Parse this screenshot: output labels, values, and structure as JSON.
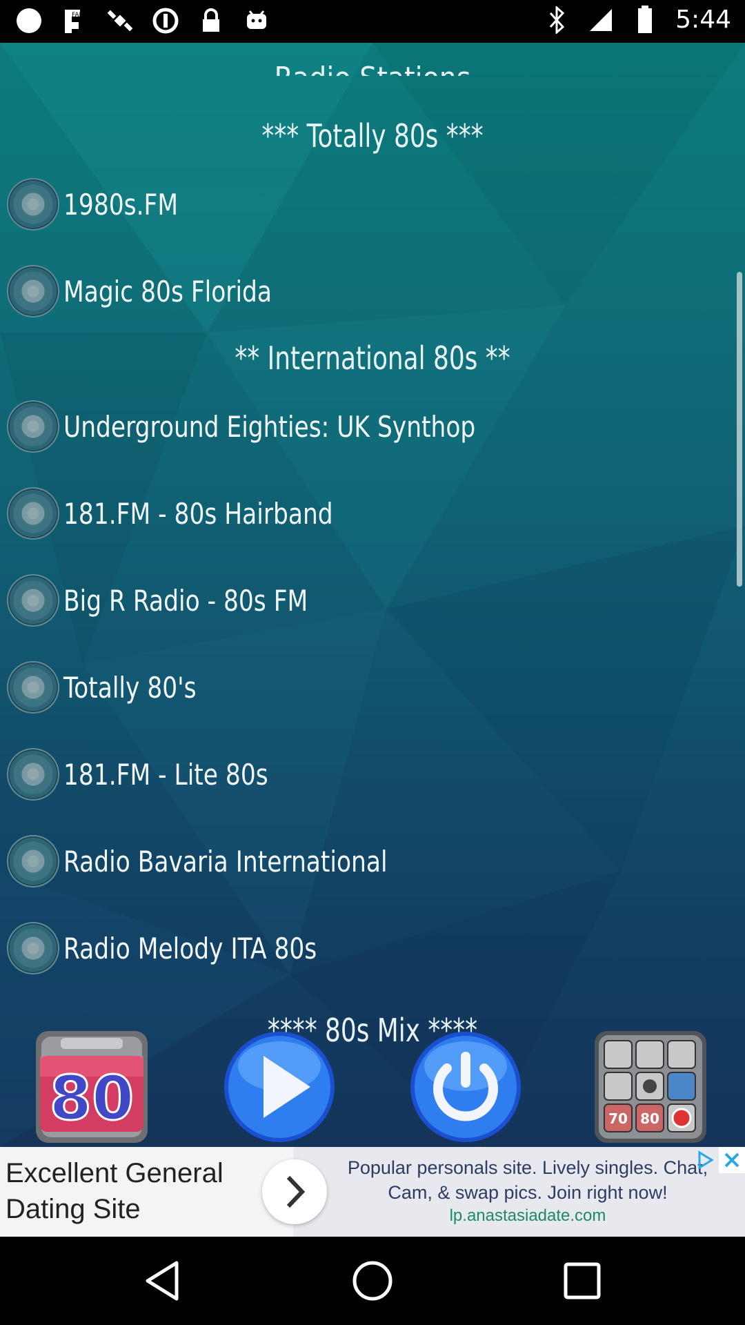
{
  "status_bar": {
    "time": "5:44",
    "icons": [
      "record-icon",
      "fake-gps-icon",
      "satellite-icon",
      "sync-icon",
      "lock-icon",
      "android-icon",
      "bluetooth-icon",
      "signal-icon",
      "battery-icon"
    ]
  },
  "header": {
    "title_partial": "Radio Stations"
  },
  "sections": [
    {
      "title": "*** Totally 80s ***",
      "stations": [
        "1980s.FM",
        "Magic 80s Florida"
      ]
    },
    {
      "title": "** International 80s **",
      "stations": [
        "Underground Eighties: UK Synthop",
        "181.FM - 80s Hairband",
        "Big R Radio - 80s FM",
        "Totally 80's",
        "181.FM - Lite 80s",
        "Radio Bavaria International",
        "Radio Melody ITA 80s"
      ]
    },
    {
      "title": "**** 80s Mix ****",
      "stations": []
    }
  ],
  "controls": {
    "left_tile_icon": "radio-80s-icon",
    "play_icon": "play-icon",
    "power_icon": "power-icon",
    "right_tile_icon": "radio-collection-icon",
    "left_tile_text": "80",
    "right_tile_labels": [
      "70",
      "80"
    ]
  },
  "ad": {
    "title": "Excellent General Dating Site",
    "text": "Popular personals site. Lively singles. Chat, Cam, & swap pics. Join right now!",
    "url": "lp.anastasiadate.com",
    "arrow_icon": "chevron-right-icon",
    "close_icon": "close-icon",
    "ad_choices_icon": "adchoices-icon"
  },
  "nav_bar": {
    "back_icon": "back-triangle-icon",
    "home_icon": "home-circle-icon",
    "recents_icon": "recents-square-icon"
  },
  "colors": {
    "accent": "#0c7b7c",
    "dark": "#14345a",
    "text": "#f2f7f7"
  }
}
